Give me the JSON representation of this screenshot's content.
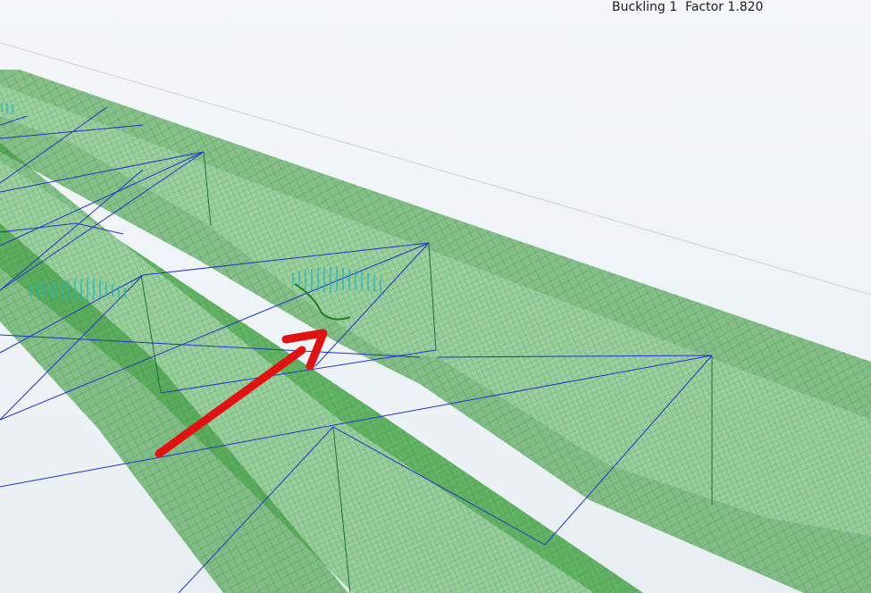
{
  "result": {
    "label": "Buckling 1  Factor 1.820",
    "mode_number": 1,
    "factor": 1.82
  },
  "scene": {
    "background": "#eef3f7",
    "plate_fill": "#3e9a3e",
    "mesh_line": "#22a322",
    "brace_line": "#2233cc",
    "load_arrows": "#1bb5c0",
    "pointer_arrow": "#e01212"
  }
}
